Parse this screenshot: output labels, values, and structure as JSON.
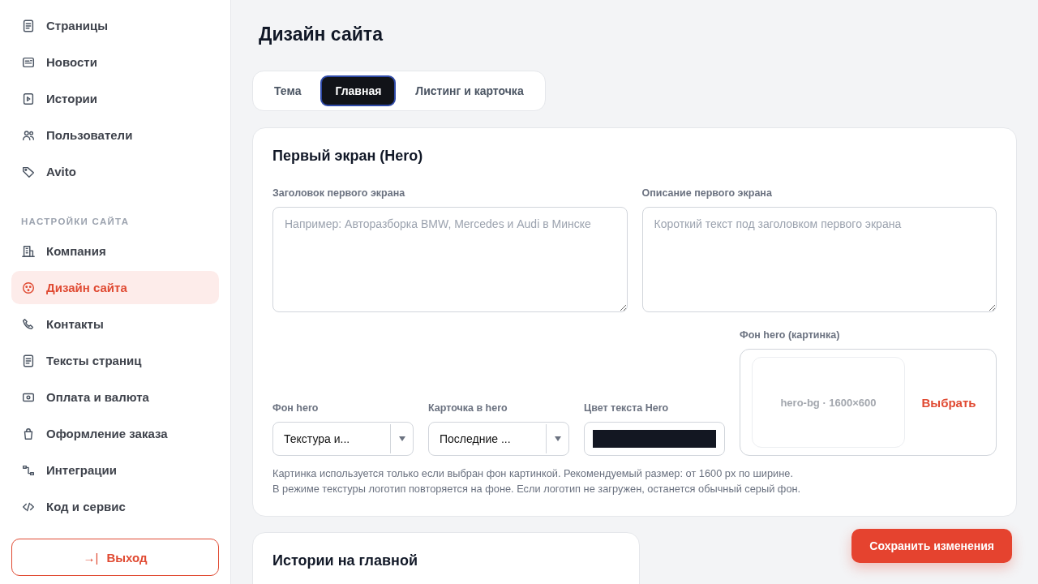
{
  "sidebar": {
    "items": [
      {
        "label": "Страницы",
        "selected": false
      },
      {
        "label": "Новости",
        "selected": false
      },
      {
        "label": "Истории",
        "selected": false
      },
      {
        "label": "Пользователи",
        "selected": false
      },
      {
        "label": "Avito",
        "selected": false
      }
    ],
    "section_title": "НАСТРОЙКИ САЙТА",
    "section_items": [
      {
        "label": "Компания",
        "selected": false
      },
      {
        "label": "Дизайн сайта",
        "selected": true
      },
      {
        "label": "Контакты",
        "selected": false
      },
      {
        "label": "Тексты страниц",
        "selected": false
      },
      {
        "label": "Оплата и валюта",
        "selected": false
      },
      {
        "label": "Оформление заказа",
        "selected": false
      },
      {
        "label": "Интеграции",
        "selected": false
      },
      {
        "label": "Код и сервис",
        "selected": false
      }
    ],
    "logout": {
      "label": "Выход",
      "icon_text": "→|"
    }
  },
  "page_title": "Дизайн сайта",
  "tabs": [
    {
      "label": "Тема",
      "selected": false
    },
    {
      "label": "Главная",
      "selected": true
    },
    {
      "label": "Листинг и карточка",
      "selected": false
    }
  ],
  "hero_card": {
    "title": "Первый экран (Hero)",
    "text_fields": [
      {
        "label": "Заголовок первого экрана",
        "placeholder": "Например: Авторазборка BMW, Mercedes и Audi в Минске"
      },
      {
        "label": "Описание первого экрана",
        "placeholder": "Короткий текст под заголовком первого экрана"
      }
    ],
    "selects": [
      {
        "label": "Фон hero",
        "value": "Текстура и..."
      },
      {
        "label": "Карточка в hero",
        "value": "Последние ..."
      }
    ],
    "color_field": {
      "label": "Цвет текста Hero",
      "color": "#131722"
    },
    "image_field": {
      "label": "Фон hero (картинка)",
      "preview": "hero-bg · 1600×600",
      "button": "Выбрать"
    },
    "notes": [
      "Картинка используется только если выбран фон картинкой. Рекомендуемый размер: от 1600 px по ширине.",
      "В режиме текстуры логотип повторяется на фоне. Если логотип не загружен, останется обычный серый фон."
    ]
  },
  "stories_card": {
    "title": "Истории на главной"
  },
  "save_button": "Сохранить изменения"
}
